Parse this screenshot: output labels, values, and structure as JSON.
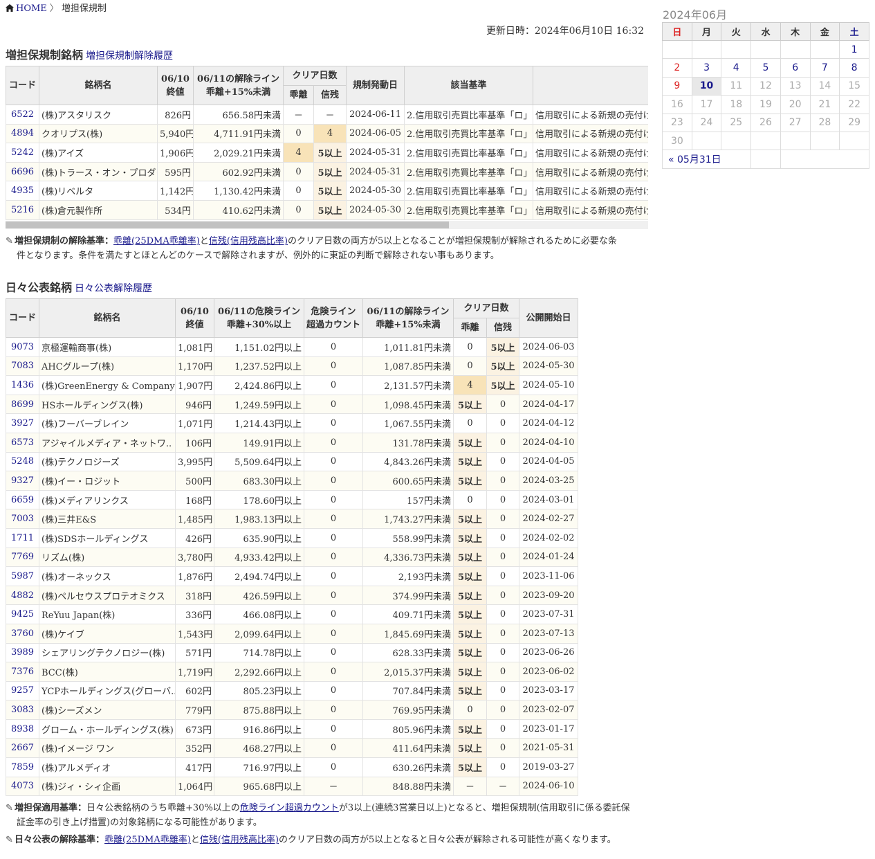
{
  "breadcrumb": {
    "home": "HOME",
    "current": "増担保規制"
  },
  "updated": "更新日時：2024年06月10日 16:32",
  "section1": {
    "title": "増担保規制銘柄",
    "link": "増担保規制解除履歴",
    "headers": {
      "code": "コード",
      "name": "銘柄名",
      "close1": "06/10",
      "close2": "終値",
      "release1": "06/11の解除ライン",
      "release2": "乖離+15%未満",
      "clear": "クリア日数",
      "kairi": "乖離",
      "shinzan": "信残",
      "date": "規制発動日",
      "criteria": "該当基準",
      "extra": ""
    },
    "rows": [
      {
        "code": "6522",
        "name": "(株)アスタリスク",
        "close": "826円",
        "line": "656.58円未満",
        "kairi": "－",
        "shinzan": "－",
        "date": "2024-06-11",
        "criteria": "2.信用取引売買比率基準「ロ」",
        "extra": "信用取引による新規の売付け"
      },
      {
        "code": "4894",
        "name": "クオリプス(株)",
        "close": "5,940円",
        "line": "4,711.91円未満",
        "kairi": "0",
        "shinzan": "4",
        "date": "2024-06-05",
        "criteria": "2.信用取引売買比率基準「ロ」",
        "extra": "信用取引による新規の売付け"
      },
      {
        "code": "5242",
        "name": "(株)アイズ",
        "close": "1,906円",
        "line": "2,029.21円未満",
        "kairi": "4",
        "shinzan": "5以上",
        "date": "2024-05-31",
        "criteria": "2.信用取引売買比率基準「ロ」",
        "extra": "信用取引による新規の売付け"
      },
      {
        "code": "6696",
        "name": "(株)トラース・オン・プロダクト",
        "close": "595円",
        "line": "602.92円未満",
        "kairi": "0",
        "shinzan": "5以上",
        "date": "2024-05-31",
        "criteria": "2.信用取引売買比率基準「ロ」",
        "extra": "信用取引による新規の売付け"
      },
      {
        "code": "4935",
        "name": "(株)リベルタ",
        "close": "1,142円",
        "line": "1,130.42円未満",
        "kairi": "0",
        "shinzan": "5以上",
        "date": "2024-05-30",
        "criteria": "2.信用取引売買比率基準「ロ」",
        "extra": "信用取引による新規の売付け"
      },
      {
        "code": "5216",
        "name": "(株)倉元製作所",
        "close": "534円",
        "line": "410.62円未満",
        "kairi": "0",
        "shinzan": "5以上",
        "date": "2024-05-30",
        "criteria": "2.信用取引売買比率基準「ロ」",
        "extra": "信用取引による新規の売付け"
      }
    ],
    "note_label": "増担保規制の解除基準：",
    "note_link1": "乖離(25DMA乖離率)",
    "note_mid": "と",
    "note_link2": "信残(信用残高比率)",
    "note_text1": "のクリア日数の両方が5以上となることが増担保規制が解除されるために必要な条",
    "note_text2": "件となります。条件を満たすとほとんどのケースで解除されますが、例外的に東証の判断で解除されない事もあります。"
  },
  "section2": {
    "title": "日々公表銘柄",
    "link": "日々公表解除履歴",
    "headers": {
      "code": "コード",
      "name": "銘柄名",
      "close1": "06/10",
      "close2": "終値",
      "danger1": "06/11の危険ライン",
      "danger2": "乖離+30%以上",
      "count1": "危険ライン",
      "count2": "超過カウント",
      "release1": "06/11の解除ライン",
      "release2": "乖離+15%未満",
      "clear": "クリア日数",
      "kairi": "乖離",
      "shinzan": "信残",
      "start": "公開開始日"
    },
    "rows": [
      {
        "code": "9073",
        "name": "京極運輸商事(株)",
        "close": "1,081円",
        "danger": "1,151.02円以上",
        "count": "0",
        "line": "1,011.81円未満",
        "kairi": "0",
        "shinzan": "5以上",
        "date": "2024-06-03"
      },
      {
        "code": "7083",
        "name": "AHCグループ(株)",
        "close": "1,170円",
        "danger": "1,237.52円以上",
        "count": "0",
        "line": "1,087.85円未満",
        "kairi": "0",
        "shinzan": "5以上",
        "date": "2024-05-30"
      },
      {
        "code": "1436",
        "name": "(株)GreenEnergy & Company",
        "close": "1,907円",
        "danger": "2,424.86円以上",
        "count": "0",
        "line": "2,131.57円未満",
        "kairi": "4",
        "shinzan": "5以上",
        "date": "2024-05-10"
      },
      {
        "code": "8699",
        "name": "HSホールディングス(株)",
        "close": "946円",
        "danger": "1,249.59円以上",
        "count": "0",
        "line": "1,098.45円未満",
        "kairi": "5以上",
        "shinzan": "0",
        "date": "2024-04-17"
      },
      {
        "code": "3927",
        "name": "(株)フーバーブレイン",
        "close": "1,071円",
        "danger": "1,214.43円以上",
        "count": "0",
        "line": "1,067.55円未満",
        "kairi": "0",
        "shinzan": "0",
        "date": "2024-04-12"
      },
      {
        "code": "6573",
        "name": "アジャイルメディア・ネットワ..",
        "close": "106円",
        "danger": "149.91円以上",
        "count": "0",
        "line": "131.78円未満",
        "kairi": "5以上",
        "shinzan": "0",
        "date": "2024-04-10"
      },
      {
        "code": "5248",
        "name": "(株)テクノロジーズ",
        "close": "3,995円",
        "danger": "5,509.64円以上",
        "count": "0",
        "line": "4,843.26円未満",
        "kairi": "5以上",
        "shinzan": "0",
        "date": "2024-04-05"
      },
      {
        "code": "9327",
        "name": "(株)イー・ロジット",
        "close": "500円",
        "danger": "683.30円以上",
        "count": "0",
        "line": "600.65円未満",
        "kairi": "5以上",
        "shinzan": "0",
        "date": "2024-03-25"
      },
      {
        "code": "6659",
        "name": "(株)メディアリンクス",
        "close": "168円",
        "danger": "178.60円以上",
        "count": "0",
        "line": "157円未満",
        "kairi": "0",
        "shinzan": "0",
        "date": "2024-03-01"
      },
      {
        "code": "7003",
        "name": "(株)三井E&S",
        "close": "1,485円",
        "danger": "1,983.13円以上",
        "count": "0",
        "line": "1,743.27円未満",
        "kairi": "5以上",
        "shinzan": "0",
        "date": "2024-02-27"
      },
      {
        "code": "1711",
        "name": "(株)SDSホールディングス",
        "close": "426円",
        "danger": "635.90円以上",
        "count": "0",
        "line": "558.99円未満",
        "kairi": "5以上",
        "shinzan": "0",
        "date": "2024-02-02"
      },
      {
        "code": "7769",
        "name": "リズム(株)",
        "close": "3,780円",
        "danger": "4,933.42円以上",
        "count": "0",
        "line": "4,336.73円未満",
        "kairi": "5以上",
        "shinzan": "0",
        "date": "2024-01-24"
      },
      {
        "code": "5987",
        "name": "(株)オーネックス",
        "close": "1,876円",
        "danger": "2,494.74円以上",
        "count": "0",
        "line": "2,193円未満",
        "kairi": "5以上",
        "shinzan": "0",
        "date": "2023-11-06"
      },
      {
        "code": "4882",
        "name": "(株)ペルセウスプロテオミクス",
        "close": "318円",
        "danger": "426.59円以上",
        "count": "0",
        "line": "374.99円未満",
        "kairi": "5以上",
        "shinzan": "0",
        "date": "2023-09-20"
      },
      {
        "code": "9425",
        "name": "ReYuu Japan(株)",
        "close": "336円",
        "danger": "466.08円以上",
        "count": "0",
        "line": "409.71円未満",
        "kairi": "5以上",
        "shinzan": "0",
        "date": "2023-07-31"
      },
      {
        "code": "3760",
        "name": "(株)ケイブ",
        "close": "1,543円",
        "danger": "2,099.64円以上",
        "count": "0",
        "line": "1,845.69円未満",
        "kairi": "5以上",
        "shinzan": "0",
        "date": "2023-07-13"
      },
      {
        "code": "3989",
        "name": "シェアリングテクノロジー(株)",
        "close": "571円",
        "danger": "714.78円以上",
        "count": "0",
        "line": "628.33円未満",
        "kairi": "5以上",
        "shinzan": "0",
        "date": "2023-06-26"
      },
      {
        "code": "7376",
        "name": "BCC(株)",
        "close": "1,719円",
        "danger": "2,292.66円以上",
        "count": "0",
        "line": "2,015.37円未満",
        "kairi": "5以上",
        "shinzan": "0",
        "date": "2023-06-02"
      },
      {
        "code": "9257",
        "name": "YCPホールディングス(グローバ..",
        "close": "602円",
        "danger": "805.23円以上",
        "count": "0",
        "line": "707.84円未満",
        "kairi": "5以上",
        "shinzan": "0",
        "date": "2023-03-17"
      },
      {
        "code": "3083",
        "name": "(株)シーズメン",
        "close": "779円",
        "danger": "875.88円以上",
        "count": "0",
        "line": "769.95円未満",
        "kairi": "0",
        "shinzan": "0",
        "date": "2023-02-07"
      },
      {
        "code": "8938",
        "name": "グローム・ホールディングス(株)",
        "close": "673円",
        "danger": "916.86円以上",
        "count": "0",
        "line": "805.96円未満",
        "kairi": "5以上",
        "shinzan": "0",
        "date": "2023-01-17"
      },
      {
        "code": "2667",
        "name": "(株)イメージ ワン",
        "close": "352円",
        "danger": "468.27円以上",
        "count": "0",
        "line": "411.64円未満",
        "kairi": "5以上",
        "shinzan": "0",
        "date": "2021-05-31"
      },
      {
        "code": "7859",
        "name": "(株)アルメディオ",
        "close": "417円",
        "danger": "716.97円以上",
        "count": "0",
        "line": "630.26円未満",
        "kairi": "5以上",
        "shinzan": "0",
        "date": "2019-03-27"
      },
      {
        "code": "4073",
        "name": "(株)ジィ・シィ企画",
        "close": "1,064円",
        "danger": "965.68円以上",
        "count": "－",
        "line": "848.88円未満",
        "kairi": "－",
        "shinzan": "－",
        "date": "2024-06-10"
      }
    ],
    "note1_label": "増担保適用基準：",
    "note1_text_a": "日々公表銘柄のうち乖離+30%以上の",
    "note1_link": "危険ライン超過カウント",
    "note1_text_b": "が3以上(連続3営業日以上)となると、増担保規制(信用取引に係る委託保",
    "note1_text_c": "証金率の引き上げ措置)の対象銘柄になる可能性があります。",
    "note2_label": "日々公表の解除基準：",
    "note2_link1": "乖離(25DMA乖離率)",
    "note2_mid": "と",
    "note2_link2": "信残(信用残高比率)",
    "note2_text": "のクリア日数の両方が5以上となると日々公表が解除される可能性が高くなります。"
  },
  "calendar": {
    "title": "2024年06月",
    "weekdays": [
      "日",
      "月",
      "火",
      "水",
      "木",
      "金",
      "土"
    ],
    "weeks": [
      [
        "",
        "",
        "",
        "",
        "",
        "",
        "1"
      ],
      [
        "2",
        "3",
        "4",
        "5",
        "6",
        "7",
        "8"
      ],
      [
        "9",
        "10",
        "11",
        "12",
        "13",
        "14",
        "15"
      ],
      [
        "16",
        "17",
        "18",
        "19",
        "20",
        "21",
        "22"
      ],
      [
        "23",
        "24",
        "25",
        "26",
        "27",
        "28",
        "29"
      ],
      [
        "30",
        "",
        "",
        "",
        "",
        "",
        ""
      ]
    ],
    "today": "10",
    "prev": "« 05月31日"
  },
  "colors": {
    "highlight": "#f8e3b8",
    "five_plus": "#fbf2e2",
    "link": "#1a1a8c",
    "sunday": "#d22"
  }
}
